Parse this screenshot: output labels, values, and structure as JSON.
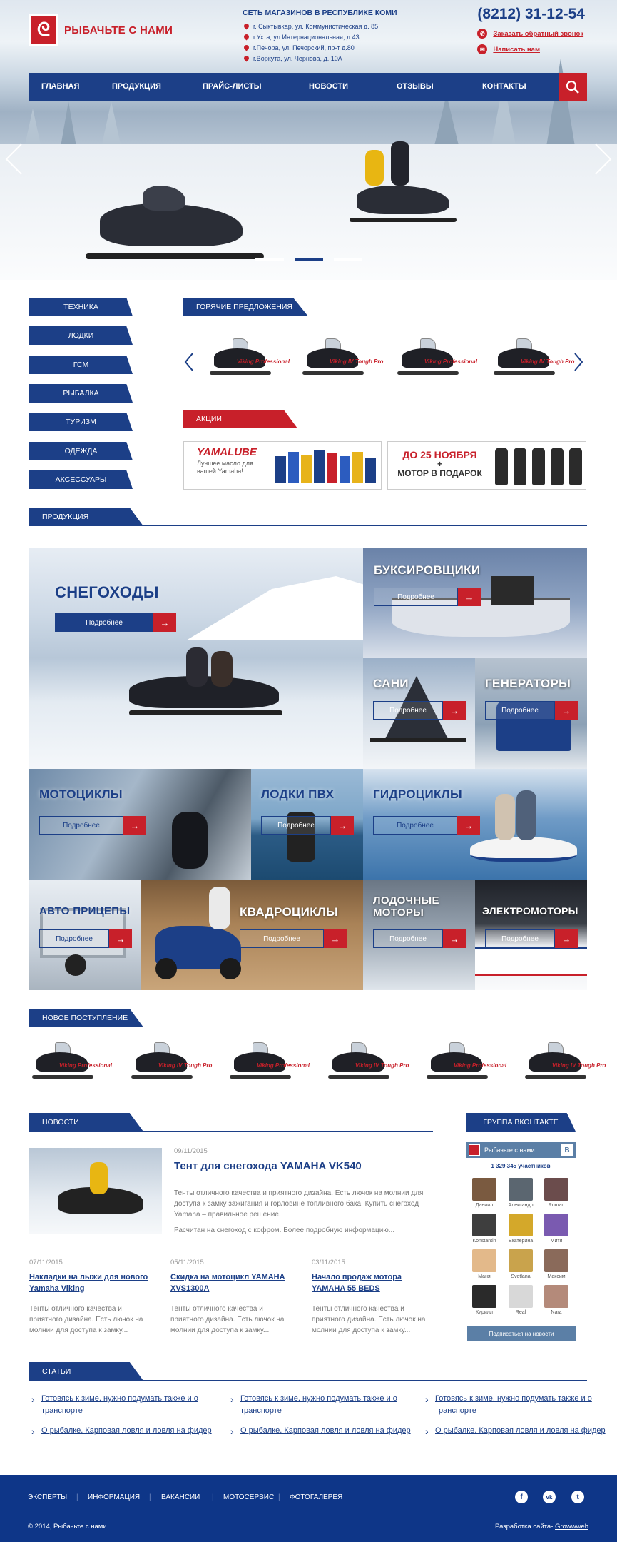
{
  "header": {
    "logo_text": "РЫБАЧЬТЕ С НАМИ",
    "stores_title": "СЕТЬ МАГАЗИНОВ В РЕСПУБЛИКЕ КОМИ",
    "stores": [
      "г. Сыктывкар, ул. Коммунистическая д. 85",
      "г.Ухта, ул.Интернациональная, д.43",
      "г.Печора,  ул. Печорский, пр-т  д.80",
      "г.Воркута, ул. Чернова,  д. 10А"
    ],
    "phone": "(8212) 31-12-54",
    "callback_label": "Заказать обратный звонок",
    "write_label": "Написать нам"
  },
  "nav": {
    "items": [
      "ГЛАВНАЯ",
      "ПРОДУКЦИЯ",
      "ПРАЙС-ЛИСТЫ",
      "НОВОСТИ",
      "ОТЗЫВЫ",
      "КОНТАКТЫ"
    ],
    "search_icon": "search-icon"
  },
  "slider": {
    "slides": 3,
    "active": 2
  },
  "sidebar": {
    "items": [
      "ТЕХНИКА",
      "ЛОДКИ",
      "ГСМ",
      "РЫБАЛКА",
      "ТУРИЗМ",
      "ОДЕЖДА",
      "АКСЕССУАРЫ"
    ]
  },
  "hot": {
    "title": "ГОРЯЧИЕ ПРЕДЛОЖЕНИЯ",
    "items": [
      "Viking Professional",
      "Viking IV Tough Pro",
      "Viking Professional",
      "Viking IV Tough Pro"
    ]
  },
  "promo": {
    "title": "АКЦИИ",
    "yamalube": {
      "brand": "YAMALUBE",
      "text": "Лучшее масло для вашей Yamaha!"
    },
    "motor": {
      "line1": "ДО 25 НОЯБРЯ",
      "plus": "+",
      "line2": "МОТОР В ПОДАРОК"
    }
  },
  "products": {
    "title": "ПРОДУКЦИЯ",
    "more": "Подробнее",
    "tiles": [
      "СНЕГОХОДЫ",
      "БУКСИРОВЩИКИ",
      "САНИ",
      "ГЕНЕРАТОРЫ",
      "МОТОЦИКЛЫ",
      "ЛОДКИ ПВХ",
      "ГИДРОЦИКЛЫ",
      "АВТО ПРИЦЕПЫ",
      "КВАДРОЦИКЛЫ",
      "ЛОДОЧНЫЕ МОТОРЫ",
      "ЭЛЕКТРОМОТОРЫ"
    ]
  },
  "new_arrivals": {
    "title": "НОВОЕ ПОСТУПЛЕНИЕ",
    "items": [
      "Viking Professional",
      "Viking IV Tough Pro",
      "Viking Professional",
      "Viking IV Tough Pro",
      "Viking Professional",
      "Viking IV Tough Pro"
    ]
  },
  "news": {
    "title": "НОВОСТИ",
    "featured": {
      "date": "09/11/2015",
      "title": "Тент для снегохода YAMAHA VK540",
      "text1": "Тенты отличного качества и приятного дизайна. Есть лючок на молнии для доступа к замку зажигания и горловине топливного бака. Купить снегоход Yamaha – правильное решение.",
      "text2": "Расчитан на снегоход с кофром. Более подробную информацию..."
    },
    "items": [
      {
        "date": "07/11/2015",
        "title": "Накладки на лыжи для нового Yamaha Viking",
        "text": "Тенты отличного качества и приятного дизайна. Есть лючок на молнии для доступа к замку..."
      },
      {
        "date": "05/11/2015",
        "title": "Скидка на мотоцикл YAMAHA XVS1300A",
        "text": "Тенты отличного качества и приятного дизайна. Есть лючок на молнии для доступа к замку..."
      },
      {
        "date": "03/11/2015",
        "title": "Начало продаж мотора YAMAHA 55 BEDS",
        "text": "Тенты отличного качества и приятного дизайна. Есть лючок на молнии для доступа к замку..."
      }
    ]
  },
  "vk": {
    "title": "ГРУППА ВКОНТАКТЕ",
    "group": "Рыбачьте с нами",
    "badge": "В",
    "members": "1 329 345 участников",
    "people": [
      "Даниил",
      "Александр",
      "Roman",
      "Konstantin",
      "Екатерина",
      "Митя",
      "Маня",
      "Svetlana",
      "Максим",
      "Кирилл",
      "Real",
      "Nara"
    ],
    "subscribe": "Подписаться на новости"
  },
  "articles": {
    "title": "СТАТЬИ",
    "items": [
      "Готовясь к зиме, нужно подумать также и о транспорте",
      "Готовясь к зиме, нужно подумать также и о транспорте",
      "Готовясь к зиме, нужно подумать также и о транспорте",
      "О рыбалке. Карповая ловля и ловля на фидер",
      "О рыбалке. Карповая ловля и ловля на фидер",
      "О рыбалке. Карповая ловля и ловля на фидер"
    ]
  },
  "footer": {
    "links": [
      "ЭКСПЕРТЫ",
      "ИНФОРМАЦИЯ",
      "ВАКАНСИИ",
      "МОТОСЕРВИС",
      "ФОТОГАЛЕРЕЯ"
    ],
    "copyright": "© 2014, Рыбачьте с нами",
    "dev_label": "Разработка сайта-",
    "dev_link": "Growwweb",
    "social": [
      "facebook-icon",
      "vk-icon",
      "twitter-icon"
    ]
  },
  "colors": {
    "brand_blue": "#1c3f87",
    "brand_red": "#c8202a",
    "footer": "#0e3688"
  }
}
